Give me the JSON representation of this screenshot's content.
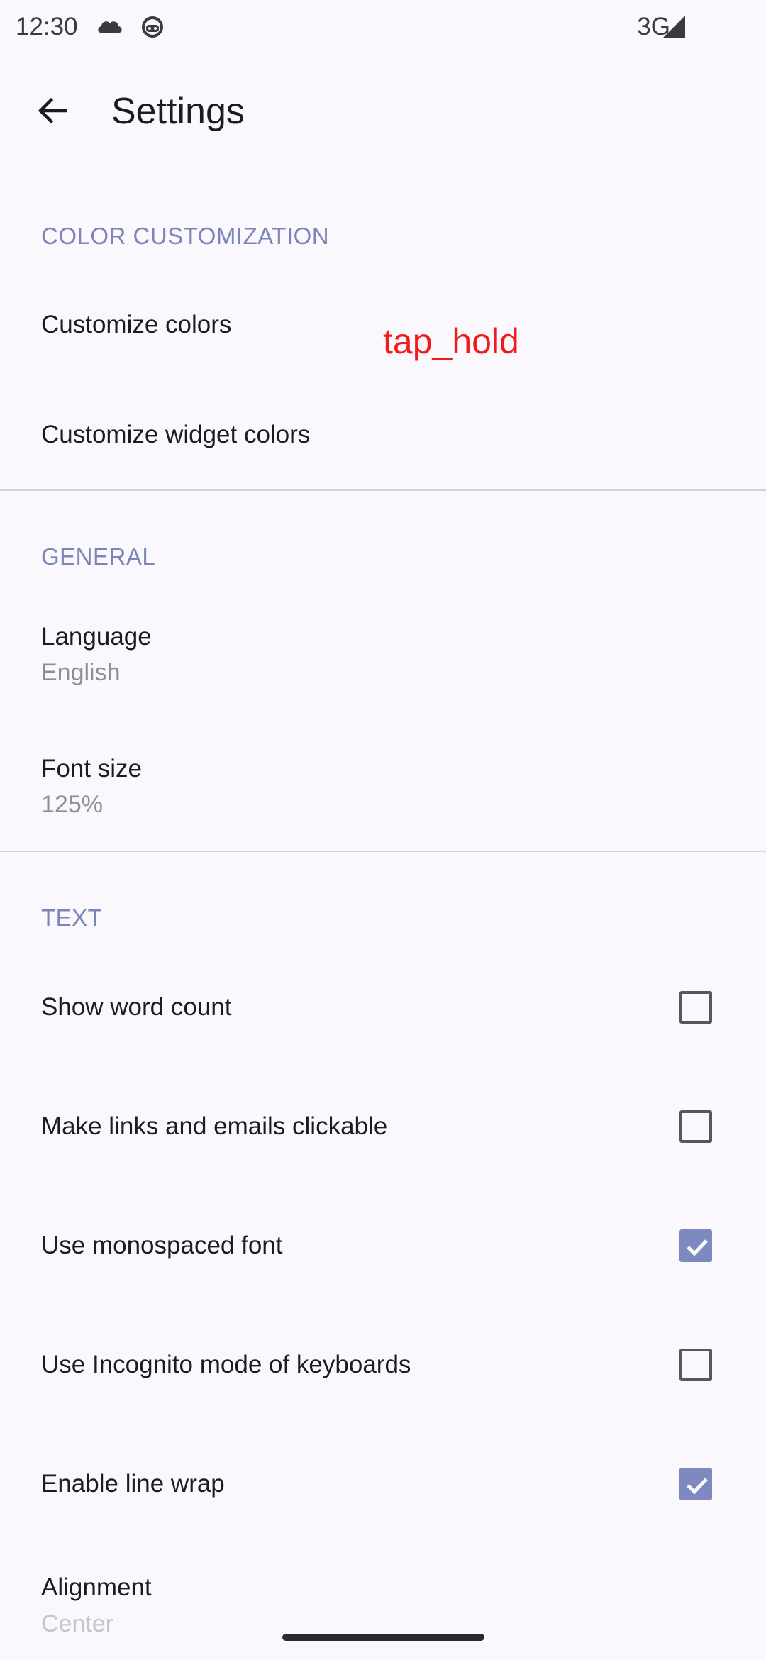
{
  "status_bar": {
    "time": "12:30",
    "network": "3G",
    "icons": [
      "cloud-icon",
      "android-icon",
      "signal-icon"
    ]
  },
  "app_bar": {
    "title": "Settings",
    "back_icon": "arrow-back-icon"
  },
  "sections": {
    "color": {
      "header": "COLOR CUSTOMIZATION",
      "items": [
        {
          "title": "Customize colors"
        },
        {
          "title": "Customize widget colors"
        }
      ]
    },
    "general": {
      "header": "GENERAL",
      "items": [
        {
          "title": "Language",
          "summary": "English"
        },
        {
          "title": "Font size",
          "summary": "125%"
        }
      ]
    },
    "text": {
      "header": "TEXT",
      "items": [
        {
          "title": "Show word count",
          "checked": false
        },
        {
          "title": "Make links and emails clickable",
          "checked": false
        },
        {
          "title": "Use monospaced font",
          "checked": true
        },
        {
          "title": "Use Incognito mode of keyboards",
          "checked": false
        },
        {
          "title": "Enable line wrap",
          "checked": true
        },
        {
          "title": "Alignment",
          "summary": "Center"
        }
      ]
    }
  },
  "annotation": "tap_hold",
  "colors": {
    "background": "#fbf8fd",
    "accent": "#7e89c0",
    "category": "#7b85b8",
    "annotation": "#ee1d1d"
  }
}
